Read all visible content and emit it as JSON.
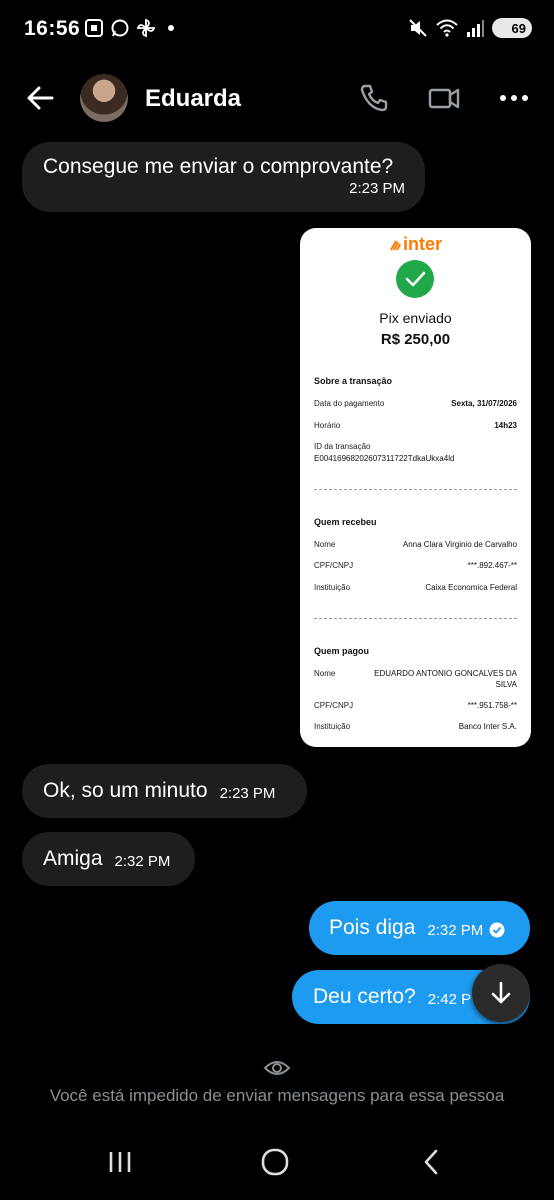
{
  "status_bar": {
    "time": "16:56",
    "battery": "69",
    "icons_left": [
      "screenshot-icon",
      "whatsapp-icon",
      "pinwheel-icon",
      "dot-icon"
    ],
    "icons_right": [
      "mute-icon",
      "wifi-icon",
      "signal-icon",
      "battery-icon"
    ]
  },
  "header": {
    "contact_name": "Eduarda"
  },
  "messages": [
    {
      "text": "Consegue me enviar o comprovante?",
      "time": "2:23 PM",
      "direction": "in"
    },
    {
      "text": "Ok, so um minuto",
      "time": "2:23 PM",
      "direction": "in"
    },
    {
      "text": "Amiga",
      "time": "2:32 PM",
      "direction": "in"
    },
    {
      "text": "Pois diga",
      "time": "2:32 PM",
      "direction": "out"
    },
    {
      "text": "Deu certo?",
      "time": "2:42 P",
      "direction": "out"
    }
  ],
  "receipt": {
    "logo": "inter",
    "title": "Pix enviado",
    "amount": "R$ 250,00",
    "section_transaction": "Sobre a transação",
    "payment_date_label": "Data do pagamento",
    "payment_date": "Sexta, 31/07/2026",
    "time_label": "Horário",
    "time": "14h23",
    "id_label": "ID da transação",
    "id": "E00416968202607311722TdkaUkxa4ld",
    "section_receiver": "Quem recebeu",
    "receiver_name_label": "Nome",
    "receiver_name": "Anna Clara Virginio de Carvalho",
    "receiver_doc_label": "CPF/CNPJ",
    "receiver_doc": "***.892.467-**",
    "receiver_inst_label": "Instituição",
    "receiver_inst": "Caixa Economica Federal",
    "section_payer": "Quem pagou",
    "payer_name_label": "Nome",
    "payer_name_1": "EDUARDO ANTONIO GONCALVES DA",
    "payer_name_2": "SILVA",
    "payer_doc_label": "CPF/CNPJ",
    "payer_doc": "***.951.758-**",
    "payer_inst_label": "Instituição",
    "payer_inst": "Banco Inter S.A."
  },
  "blocked_notice": "Você está impedido de enviar mensagens para essa pessoa",
  "colors": {
    "background": "#000000",
    "incoming_bubble": "#1e1e1e",
    "outgoing_bubble": "#1d9bf0",
    "muted_text": "#8a8f94",
    "inter_orange": "#ff7a00",
    "success_green": "#21a849"
  }
}
